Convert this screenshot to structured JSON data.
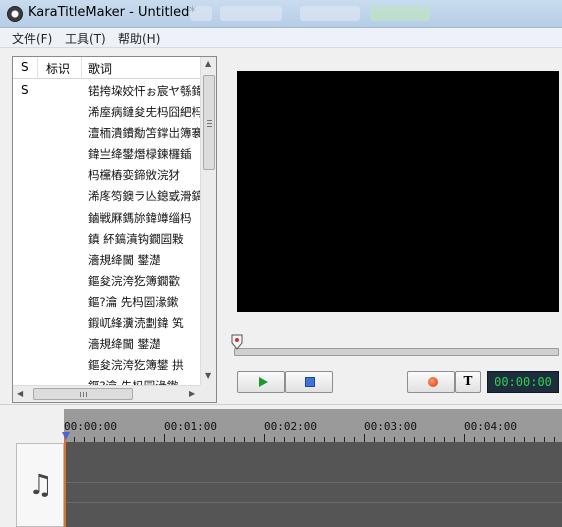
{
  "window": {
    "title": "KaraTitleMaker - Untitled*"
  },
  "menu": {
    "file": "文件(F)",
    "tools": "工具(T)",
    "help": "帮助(H)"
  },
  "list": {
    "columns": {
      "s": "S",
      "tag": "标识",
      "lyrics": "歌词"
    },
    "rows": [
      {
        "s": "S",
        "lyric": "锘挎垜姣忓ぉ宸ヤ綔鍏"
      },
      {
        "s": "",
        "lyric": "浠庢病鏈夋兂杩囧紦杩"
      },
      {
        "s": "",
        "lyric": "澶栭潰鐨勪笘鐣岀簿褰"
      },
      {
        "s": "",
        "lyric": "鍏亗绛鐢熸椂鍊欏鍤"
      },
      {
        "s": "",
        "lyric": "杩欓樁娈鍗敓浣犲"
      },
      {
        "s": "",
        "lyric": "浠庝笉鐭ラ亾鎴戜滑鎬"
      },
      {
        "s": "",
        "lyric": "鏀戦厤鎷旀鍏竴缁杩"
      },
      {
        "s": "",
        "lyric": "鎮  紑鎬濆钩鐗囩敤"
      },
      {
        "s": "",
        "lyric": "濇規绛閫      鐢濋"
      },
      {
        "s": "",
        "lyric": "鏂夋浣洿犵簿鐗歡"
      },
      {
        "s": "",
        "lyric": "鏂?瀹   先杩囩湪鏉"
      },
      {
        "s": "",
        "lyric": "鍜屼綘瀵涜劃鍏  笂"
      },
      {
        "s": "",
        "lyric": "濇規绛閫      鐢濋"
      },
      {
        "s": "",
        "lyric": "鏂夋浣洿犵簿鐢   拱"
      },
      {
        "s": "",
        "lyric": "鏂?瀹   先杩囩湪鏉"
      }
    ]
  },
  "player": {
    "time": "00:00:00",
    "text_button": "T"
  },
  "timeline": {
    "marks": [
      "00:00:00",
      "00:01:00",
      "00:02:00",
      "00:03:00",
      "00:04:00"
    ]
  },
  "colors": {
    "time_text": "#2fd14a",
    "video_bg": "#000000",
    "playhead": "#d6742f"
  }
}
